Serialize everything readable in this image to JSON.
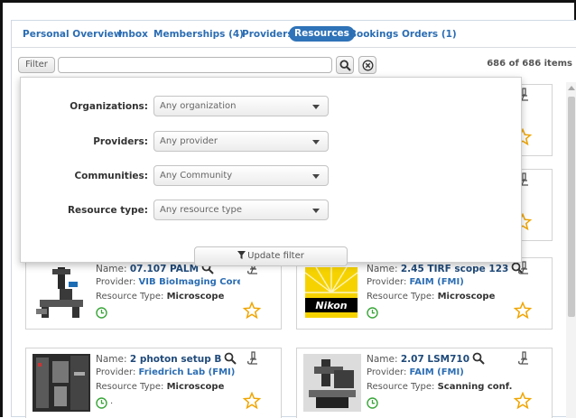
{
  "tabs": [
    {
      "label": "Personal Overview"
    },
    {
      "label": "Inbox"
    },
    {
      "label": "Memberships (4)"
    },
    {
      "label": "Providers"
    },
    {
      "label": "Resources",
      "active": true
    },
    {
      "label": "Bookings"
    },
    {
      "label": "Orders (1)"
    }
  ],
  "toolbar": {
    "filter_label": "Filter",
    "search_value": "",
    "search_placeholder": "",
    "items_count": "686 of 686 items"
  },
  "filter_panel": {
    "rows": [
      {
        "label": "Organizations:",
        "value": "Any organization"
      },
      {
        "label": "Providers:",
        "value": "Any provider"
      },
      {
        "label": "Communities:",
        "value": "Any Community"
      },
      {
        "label": "Resource type:",
        "value": "Any resource type"
      }
    ],
    "update_label": "Update filter"
  },
  "resources": [
    {
      "name_prefix": "Name: ",
      "name": "07.107 PALM",
      "provider_prefix": "Provider: ",
      "provider": "VIB BioImaging Core...",
      "type_prefix": "Resource Type: ",
      "type": "Microscope",
      "extra": ""
    },
    {
      "name_prefix": "Name: ",
      "name": "2.45 TIRF scope 123",
      "provider_prefix": "Provider: ",
      "provider": "FAIM (FMI)",
      "type_prefix": "Resource Type: ",
      "type": "Microscope",
      "extra": "",
      "logo_text": "Nikon"
    },
    {
      "name_prefix": "Name: ",
      "name": "2 photon setup B",
      "provider_prefix": "Provider: ",
      "provider": "Friedrich Lab (FMI)",
      "type_prefix": "Resource Type: ",
      "type": "Microscope",
      "extra": "."
    },
    {
      "name_prefix": "Name: ",
      "name": "2.07 LSM710",
      "provider_prefix": "Provider: ",
      "provider": "FAIM (FMI)",
      "type_prefix": "Resource Type: ",
      "type": "Scanning conf...",
      "extra": ""
    }
  ],
  "colors": {
    "accent": "#2f73b8",
    "link": "#2b6db3",
    "clock": "#3aa63a",
    "star": "#f0a500"
  },
  "icons": [
    "search-icon",
    "clear-icon",
    "filter-icon",
    "microscope-icon",
    "star-icon",
    "clock-icon",
    "magnifier-icon"
  ]
}
